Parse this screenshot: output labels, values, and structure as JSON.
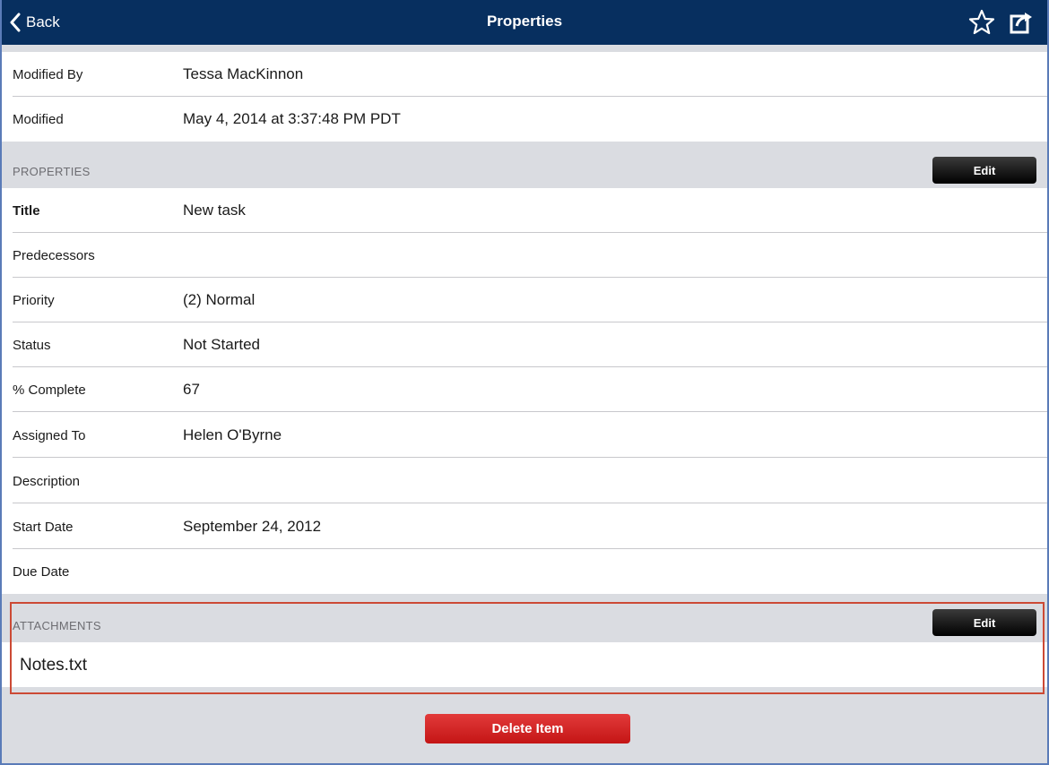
{
  "navbar": {
    "back_label": "Back",
    "title": "Properties",
    "icons": [
      "star-icon",
      "share-icon"
    ]
  },
  "meta_rows": [
    {
      "label": "Modified By",
      "value": "Tessa MacKinnon"
    },
    {
      "label": "Modified",
      "value": "May 4, 2014 at 3:37:48 PM PDT"
    }
  ],
  "properties_section": {
    "title": "PROPERTIES",
    "edit_label": "Edit"
  },
  "property_rows": [
    {
      "label": "Title",
      "value": "New task"
    },
    {
      "label": "Predecessors",
      "value": ""
    },
    {
      "label": "Priority",
      "value": "(2) Normal"
    },
    {
      "label": "Status",
      "value": "Not Started"
    },
    {
      "label": "% Complete",
      "value": "67"
    },
    {
      "label": "Assigned To",
      "value": "Helen O'Byrne"
    },
    {
      "label": "Description",
      "value": ""
    },
    {
      "label": "Start Date",
      "value": "September 24, 2012"
    },
    {
      "label": "Due Date",
      "value": ""
    }
  ],
  "attachments_section": {
    "title": "ATTACHMENTS",
    "edit_label": "Edit",
    "items": [
      {
        "name": "Notes.txt"
      }
    ]
  },
  "delete_label": "Delete Item",
  "colors": {
    "navbar": "#072f5f",
    "section_bg": "#dadce1",
    "delete": "#d42424",
    "highlight": "#cc4a35"
  }
}
